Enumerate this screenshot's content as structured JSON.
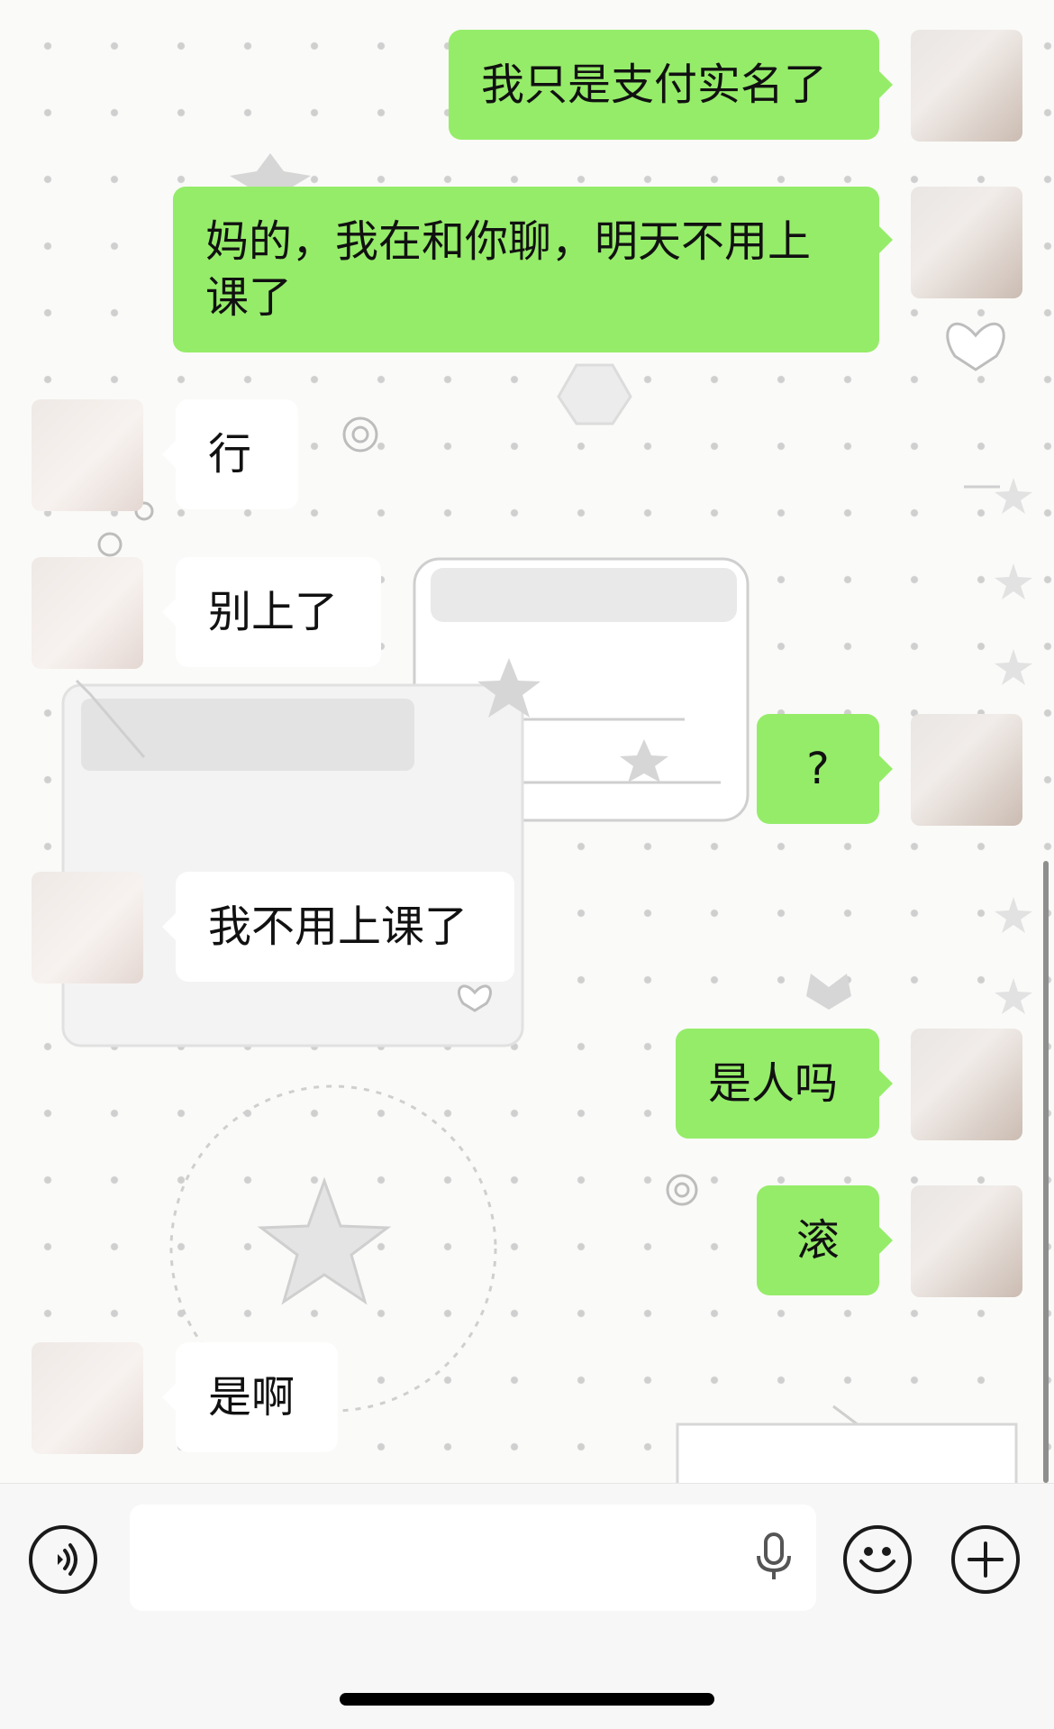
{
  "messages": [
    {
      "side": "out",
      "text": "我只是支付实名了"
    },
    {
      "side": "out",
      "text": "妈的，我在和你聊，明天不用上课了"
    },
    {
      "side": "in",
      "text": "行"
    },
    {
      "side": "in",
      "text": "别上了"
    },
    {
      "side": "out",
      "text": "?"
    },
    {
      "side": "in",
      "text": "我不用上课了"
    },
    {
      "side": "out",
      "text": "是人吗"
    },
    {
      "side": "out",
      "text": "滚"
    },
    {
      "side": "in",
      "text": "是啊"
    }
  ],
  "input_bar": {
    "voice_icon": "voice-wave-icon",
    "mic_icon": "microphone-icon",
    "emoji_icon": "smiley-icon",
    "add_icon": "plus-icon"
  },
  "colors": {
    "outgoing_bubble": "#95ec69",
    "incoming_bubble": "#ffffff",
    "background": "#fafaf8"
  }
}
